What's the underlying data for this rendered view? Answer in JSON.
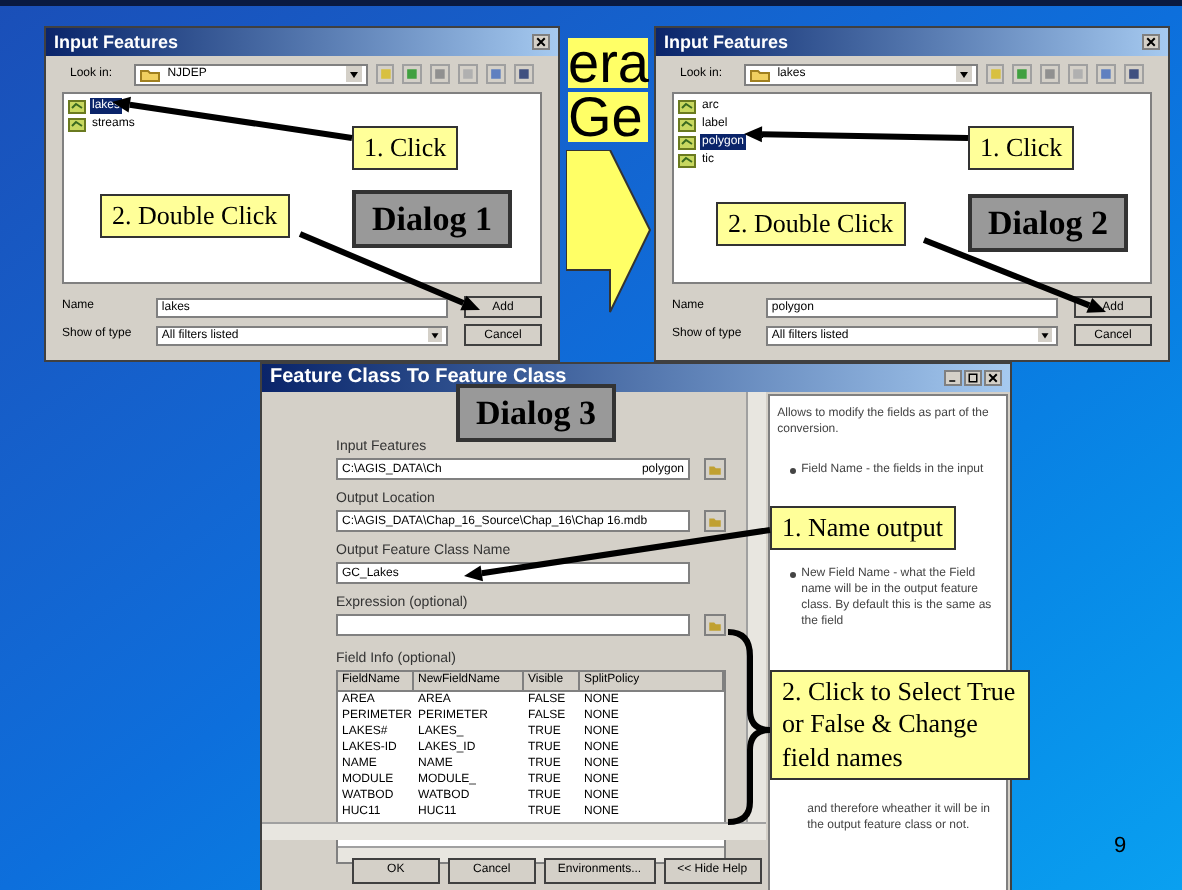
{
  "slide": {
    "title_fragments": [
      "era",
      "Ge"
    ],
    "page_number": "9"
  },
  "dialogs": [
    {
      "title": "Input Features",
      "look_in_label": "Look in:",
      "look_in": "NJDEP",
      "items": [
        {
          "name": "lakes",
          "selected": true
        },
        {
          "name": "streams",
          "selected": false
        }
      ],
      "name_label": "Name",
      "name_value": "lakes",
      "type_label": "Show of type",
      "type_value": "All filters listed",
      "buttons": [
        "Add",
        "Cancel"
      ],
      "badge": "Dialog 1",
      "callouts": [
        "1. Click",
        "2. Double Click"
      ]
    },
    {
      "title": "Input Features",
      "look_in_label": "Look in:",
      "look_in": "lakes",
      "items": [
        {
          "name": "arc",
          "selected": false
        },
        {
          "name": "label",
          "selected": false
        },
        {
          "name": "polygon",
          "selected": true
        },
        {
          "name": "tic",
          "selected": false
        }
      ],
      "name_label": "Name",
      "name_value": "polygon",
      "type_label": "Show of type",
      "type_value": "All filters listed",
      "buttons": [
        "Add",
        "Cancel"
      ],
      "badge": "Dialog 2",
      "callouts": [
        "1. Click",
        "2. Double Click"
      ]
    }
  ],
  "feature_dialog": {
    "title": "Feature Class To Feature Class",
    "badge": "Dialog 3",
    "fields": [
      {
        "label": "Input Features",
        "value_parts": [
          "C:\\AGIS_DATA\\Ch",
          "polygon"
        ],
        "browse": true
      },
      {
        "label": "Output Location",
        "value_parts": [
          "C:\\AGIS_DATA\\Chap_16_Source\\Chap_16\\Chap 16.mdb"
        ],
        "browse": true
      },
      {
        "label": "Output Feature Class Name",
        "value_parts": [
          "GC_Lakes"
        ],
        "browse": false
      },
      {
        "label": "Expression (optional)",
        "browse": true
      }
    ],
    "table": {
      "label": "Field Info (optional)",
      "columns": [
        "FieldName",
        "NewFieldName",
        "Visible",
        "SplitPolicy"
      ],
      "rows": [
        [
          "AREA",
          "AREA",
          "FALSE",
          "NONE"
        ],
        [
          "PERIMETER",
          "PERIMETER",
          "FALSE",
          "NONE"
        ],
        [
          "LAKES#",
          "LAKES_",
          "TRUE",
          "NONE"
        ],
        [
          "LAKES-ID",
          "LAKES_ID",
          "TRUE",
          "NONE"
        ],
        [
          "NAME",
          "NAME",
          "TRUE",
          "NONE"
        ],
        [
          "MODULE",
          "MODULE_",
          "TRUE",
          "NONE"
        ],
        [
          "WATBOD",
          "WATBOD",
          "TRUE",
          "NONE"
        ],
        [
          "HUC11",
          "HUC11",
          "TRUE",
          "NONE"
        ]
      ]
    },
    "buttons": [
      "OK",
      "Cancel",
      "Environments...",
      "<< Hide Help"
    ],
    "help": [
      {
        "kind": "paragraph",
        "text": "Allows to modify the fields as part of the conversion."
      },
      {
        "kind": "bullet",
        "text": "Field Name - the fields in the input"
      },
      {
        "kind": "bullet",
        "text": "New Field Name - what the Field name will be in the output feature class. By default this is the same as the field"
      },
      {
        "kind": "continuation",
        "text": "and therefore wheather it will be in the output feature class or not."
      }
    ],
    "callouts": [
      "1. Name output",
      "2. Click to Select True or False & Change field names"
    ]
  }
}
